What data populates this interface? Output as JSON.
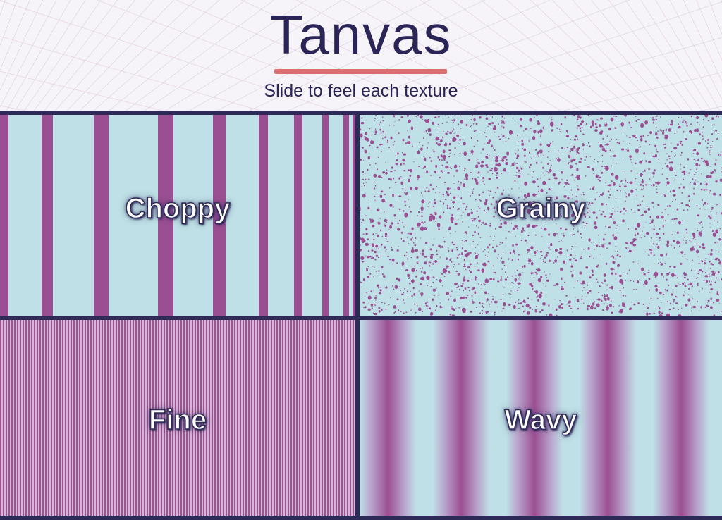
{
  "brand": {
    "logo_text": "Tanvas",
    "subtitle": "Slide to feel each texture",
    "accent_color": "#d9706f",
    "text_color": "#2b2457"
  },
  "colors": {
    "light": "#bfe0e7",
    "dark": "#9b4f93",
    "border": "#2e2a58",
    "background": "#f6f4f8"
  },
  "textures": [
    {
      "label": "Choppy"
    },
    {
      "label": "Grainy"
    },
    {
      "label": "Fine"
    },
    {
      "label": "Wavy"
    }
  ]
}
